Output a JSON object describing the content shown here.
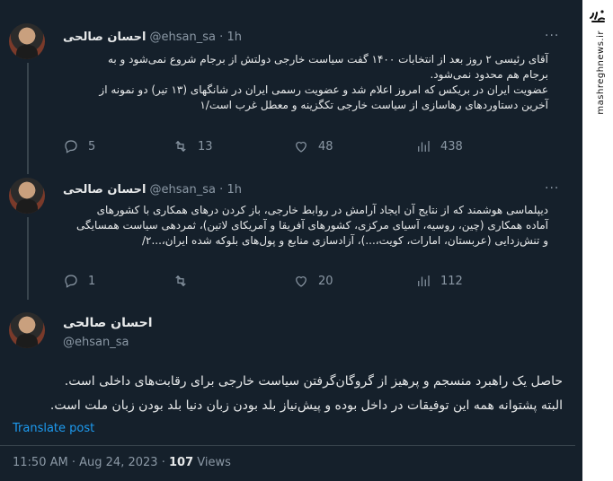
{
  "tweets": [
    {
      "name": "احسان صالحی",
      "handle": "@ehsan_sa",
      "time": "1h",
      "text_lines": [
        "آقای رئیسی ۲ روز بعد از انتخابات ۱۴۰۰ گفت سیاست خارجی دولتش از برجام شروع نمی‌شود و به",
        "برجام هم محدود نمی‌شود.",
        "عضویت ایران در بریکس که امروز اعلام شد و عضویت رسمی ایران در شانگهای (۱۳ تیر) دو نمونه از",
        "آخرین دستاوردهای رهاسازی از سیاست خارجی تکگزینه و معطل غرب است/۱"
      ],
      "replies": "5",
      "retweets": "13",
      "likes": "48",
      "views": "438"
    },
    {
      "name": "احسان صالحی",
      "handle": "@ehsan_sa",
      "time": "1h",
      "text_lines": [
        "دیپلماسی هوشمند که از نتایج آن ایجاد آرامش در روابط خارجی، باز کردن درهای همکاری با کشورهای",
        "آماده همکاری (چین، روسیه، آسیای مرکزی، کشورهای آفریقا و آمریکای لاتین)، ثمردهی سیاست همسایگی",
        "و تنش‌زدایی (عربستان، امارات، کویت،...)، آزادسازی منابع و پول‌های بلوکه شده ایران،...۲/"
      ],
      "replies": "1",
      "retweets": "",
      "likes": "20",
      "views": "112"
    }
  ],
  "main": {
    "name": "احسان صالحی",
    "handle": "@ehsan_sa",
    "text_lines": [
      "حاصل یک راهبرد منسجم و پرهیز از گروگان‌گرفتن سیاست خارجی برای رقابت‌های داخلی است.",
      "البته پشتوانه همه این توفیقات در داخل بوده و پیش‌نیاز بلد بودن زبان دنیا بلد بودن زبان ملت است."
    ],
    "translate": "Translate post",
    "time": "11:50 AM",
    "date": "Aug 24, 2023",
    "views_count": "107",
    "views_label": "Views"
  },
  "watermark": {
    "text": "mashreghnews.ir"
  },
  "colors": {
    "background": "#15202b",
    "accent": "#1d9bf0",
    "muted": "#8b98a5",
    "border": "#38444d"
  }
}
